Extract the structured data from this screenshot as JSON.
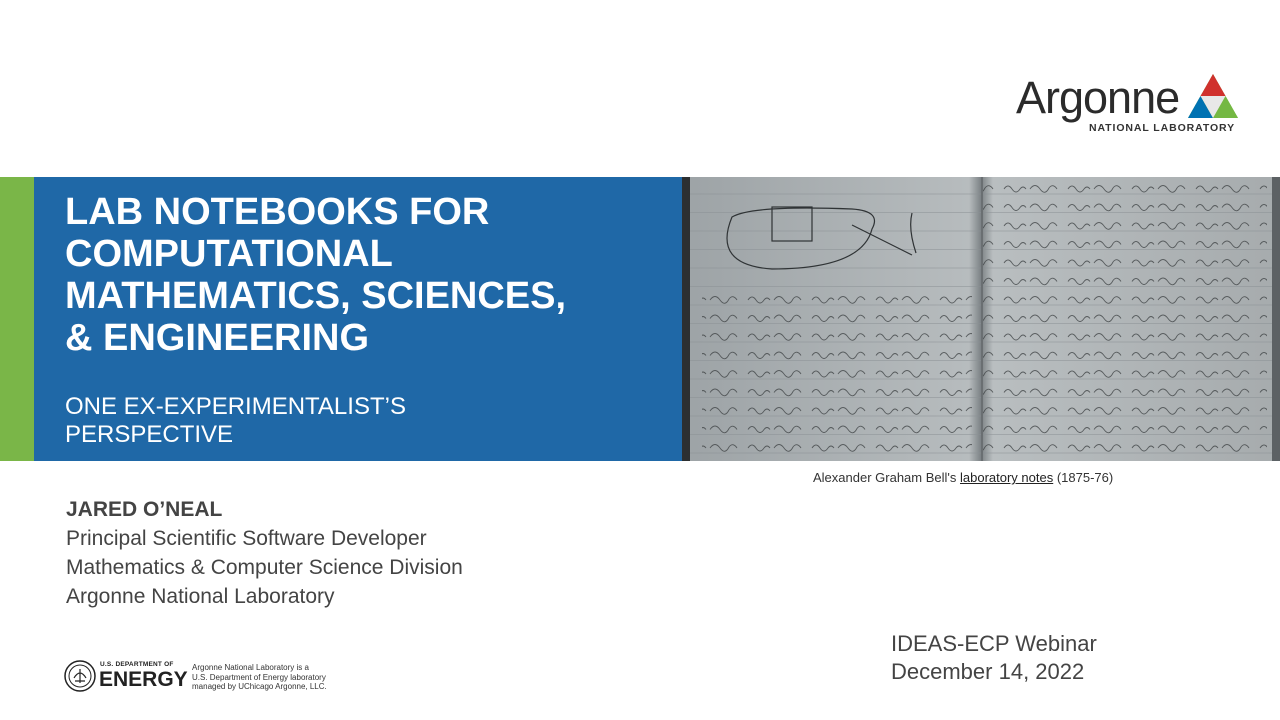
{
  "logo": {
    "name": "Argonne",
    "sub": "NATIONAL LABORATORY",
    "colors": [
      "#0072b2",
      "#d0312d",
      "#74b843"
    ]
  },
  "title": {
    "lines": [
      "LAB NOTEBOOKS FOR",
      "COMPUTATIONAL",
      "MATHEMATICS, SCIENCES,",
      "& ENGINEERING"
    ],
    "subtitle_lines": [
      "ONE EX-EXPERIMENTALIST’S",
      "PERSPECTIVE"
    ]
  },
  "photo": {
    "icon": "handwritten-notebook-image"
  },
  "caption": {
    "prefix": "Alexander Graham Bell's ",
    "link": "laboratory notes",
    "suffix": " (1875-76)"
  },
  "author": {
    "name": "JARED O’NEAL",
    "role": "Principal Scientific Software Developer",
    "division": "Mathematics & Computer Science Division",
    "org": "Argonne National Laboratory"
  },
  "event": {
    "name": "IDEAS-ECP Webinar",
    "date": "December 14, 2022"
  },
  "doe": {
    "small": "U.S. DEPARTMENT OF",
    "big": "ENERGY",
    "text_lines": [
      "Argonne National Laboratory is a",
      "U.S. Department of Energy laboratory",
      "managed by UChicago Argonne, LLC."
    ]
  },
  "colors": {
    "blue": "#1f68a7",
    "green": "#7ab648"
  }
}
